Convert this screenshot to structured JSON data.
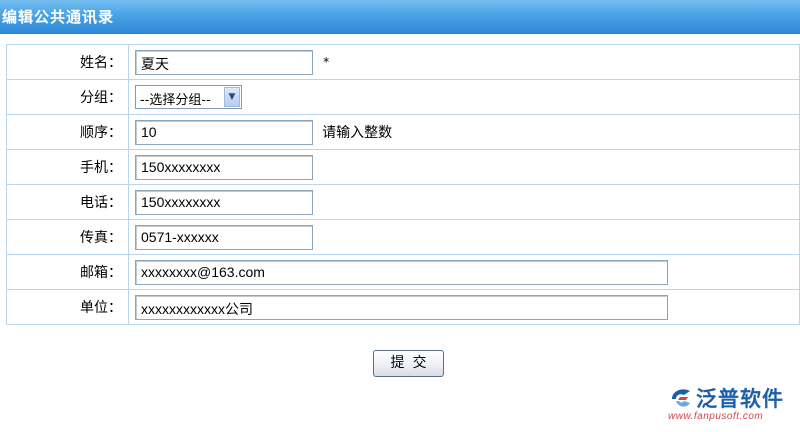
{
  "window": {
    "title": "编辑公共通讯录"
  },
  "form": {
    "name": {
      "label": "姓名：",
      "value": "夏天",
      "required_mark": "*"
    },
    "group": {
      "label": "分组：",
      "selected": "--选择分组--"
    },
    "order": {
      "label": "顺序：",
      "value": "10",
      "hint": "请输入整数"
    },
    "mobile": {
      "label": "手机：",
      "value": "150xxxxxxxx"
    },
    "phone": {
      "label": "电话：",
      "value": "150xxxxxxxx"
    },
    "fax": {
      "label": "传真：",
      "value": "0571-xxxxxx"
    },
    "email": {
      "label": "邮箱：",
      "value": "xxxxxxxx@163.com"
    },
    "company": {
      "label": "单位：",
      "value": "xxxxxxxxxxxx公司"
    }
  },
  "actions": {
    "submit_label": "提交"
  },
  "watermark": {
    "name": "泛普软件",
    "url": "www.fanpusoft.com"
  },
  "colors": {
    "titlebar": "#3d98df",
    "border": "#b9d6ec",
    "brand": "#1b5fae"
  }
}
